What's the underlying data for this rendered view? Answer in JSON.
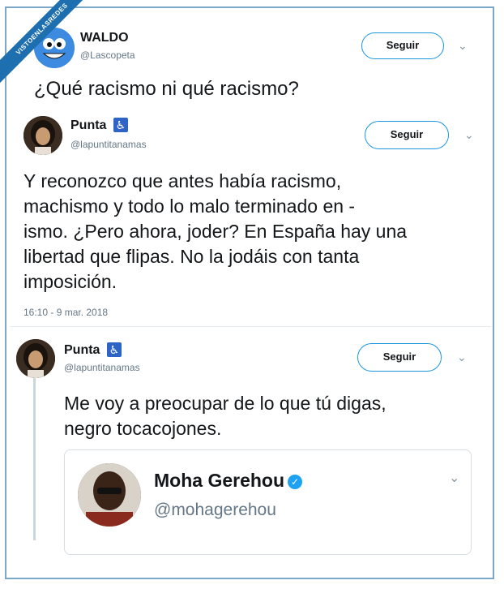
{
  "watermark": "VISTOENLASREDES",
  "tweet_top": {
    "name": "WALDO",
    "handle": "@Lascopeta",
    "follow_label": "Seguir",
    "text": "¿Qué racismo ni qué racismo?"
  },
  "tweet_main": {
    "name": "Punta",
    "badge": "♿",
    "handle": "@lapuntitanamas",
    "follow_label": "Seguir",
    "text_lines": [
      "Y reconozco que antes había racismo,",
      "machismo y todo lo malo terminado en -",
      "ismo. ¿Pero ahora, joder? En España hay una",
      "libertad que flipas. No la jodáis con tanta",
      "imposición."
    ],
    "timestamp": "16:10 - 9 mar. 2018"
  },
  "tweet_reply": {
    "name": "Punta",
    "badge": "♿",
    "handle": "@lapuntitanamas",
    "follow_label": "Seguir",
    "text_lines": [
      "Me voy a preocupar de lo que tú digas,",
      "negro tocacojones."
    ]
  },
  "quoted": {
    "name": "Moha Gerehou",
    "handle": "@mohagerehou",
    "verified_icon": "✓"
  },
  "colors": {
    "accent": "#1da1f2",
    "border": "#7aa6c8",
    "muted": "#657786"
  }
}
